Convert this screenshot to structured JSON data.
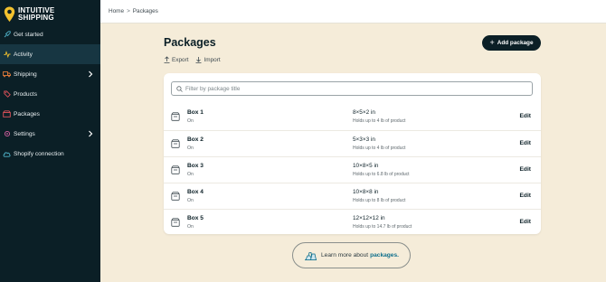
{
  "brand": {
    "line1": "INTUITIVE",
    "line2": "SHIPPING"
  },
  "sidebar": {
    "items": [
      {
        "label": "Get started",
        "icon": "rocket-icon"
      },
      {
        "label": "Activity",
        "icon": "activity-icon"
      },
      {
        "label": "Shipping",
        "icon": "truck-icon"
      },
      {
        "label": "Products",
        "icon": "tag-icon"
      },
      {
        "label": "Packages",
        "icon": "package-icon"
      },
      {
        "label": "Settings",
        "icon": "gear-icon"
      },
      {
        "label": "Shopify connection",
        "icon": "cloud-icon"
      }
    ]
  },
  "breadcrumb": {
    "home": "Home",
    "separator": ">",
    "current": "Packages"
  },
  "page": {
    "title": "Packages"
  },
  "toolbar": {
    "add_label": "Add package",
    "export_label": "Export",
    "import_label": "Import"
  },
  "search": {
    "placeholder": "Filter by package title"
  },
  "packages": [
    {
      "name": "Box 1",
      "status": "On",
      "dims": "8×5×2 in",
      "holds": "Holds up to 4 lb of product"
    },
    {
      "name": "Box 2",
      "status": "On",
      "dims": "5×3×3 in",
      "holds": "Holds up to 4 lb of product"
    },
    {
      "name": "Box 3",
      "status": "On",
      "dims": "10×8×5 in",
      "holds": "Holds up to 6.8 lb of product"
    },
    {
      "name": "Box 4",
      "status": "On",
      "dims": "10×8×8 in",
      "holds": "Holds up to 8 lb of product"
    },
    {
      "name": "Box 5",
      "status": "On",
      "dims": "12×12×12 in",
      "holds": "Holds up to 14.7 lb of product"
    }
  ],
  "row_action": "Edit",
  "learn": {
    "text": "Learn more about",
    "link": "packages."
  },
  "colors": {
    "sidebar_bg": "#0b1f26",
    "page_bg": "#f5ecd9",
    "logo_yellow": "#f2c12e",
    "link": "#0e6f8c"
  }
}
